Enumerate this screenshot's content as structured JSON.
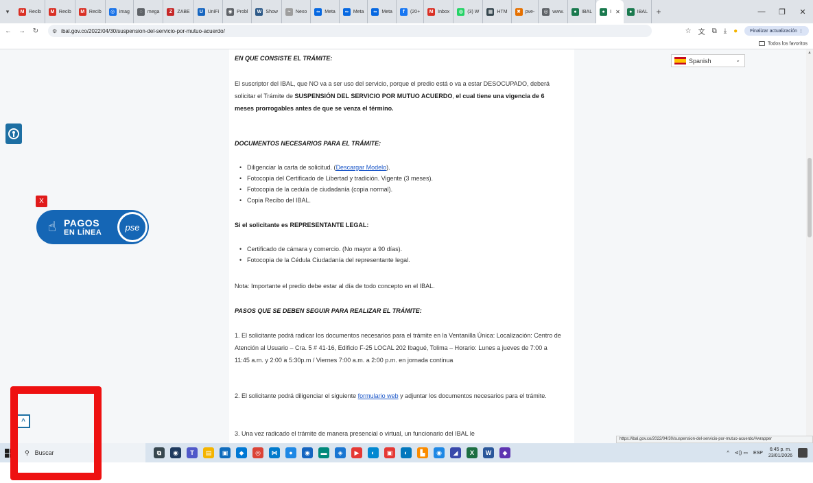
{
  "browser": {
    "tab_menu_icon": "chevron-down-icon",
    "tabs": [
      {
        "label": "Recib",
        "icon": "gmail-icon",
        "color": "#d93025",
        "glyph": "M"
      },
      {
        "label": "Recib",
        "icon": "gmail-icon",
        "color": "#d93025",
        "glyph": "M"
      },
      {
        "label": "Recib",
        "icon": "gmail-icon",
        "color": "#d93025",
        "glyph": "M"
      },
      {
        "label": "imag",
        "icon": "image-icon",
        "color": "#1a73e8",
        "glyph": "◎"
      },
      {
        "label": "mega",
        "icon": "globe-icon",
        "color": "#5f6368",
        "glyph": "◌"
      },
      {
        "label": "ZABE",
        "icon": "zabbix-icon",
        "color": "#c62828",
        "glyph": "Z"
      },
      {
        "label": "UniFi",
        "icon": "unifi-icon",
        "color": "#1565c0",
        "glyph": "U"
      },
      {
        "label": "Probl",
        "icon": "globe-icon",
        "color": "#5f6368",
        "glyph": "◉"
      },
      {
        "label": "Show",
        "icon": "app-icon",
        "color": "#2e5a88",
        "glyph": "W"
      },
      {
        "label": "Nexo",
        "icon": "cloud-icon",
        "color": "#9e9e9e",
        "glyph": "~"
      },
      {
        "label": "Meta",
        "icon": "meta-icon",
        "color": "#0668e1",
        "glyph": "∞"
      },
      {
        "label": "Meta",
        "icon": "meta-icon",
        "color": "#0668e1",
        "glyph": "∞"
      },
      {
        "label": "Meta",
        "icon": "meta-icon",
        "color": "#0668e1",
        "glyph": "∞"
      },
      {
        "label": "(20+",
        "icon": "facebook-icon",
        "color": "#1877f2",
        "glyph": "f"
      },
      {
        "label": "Inbox",
        "icon": "gmail-icon",
        "color": "#d93025",
        "glyph": "M"
      },
      {
        "label": "(3) W",
        "icon": "whatsapp-icon",
        "color": "#25d366",
        "glyph": "◍"
      },
      {
        "label": "HTM",
        "icon": "html-icon",
        "color": "#37474f",
        "glyph": "▦"
      },
      {
        "label": "pve-",
        "icon": "proxmox-icon",
        "color": "#e57000",
        "glyph": "✖"
      },
      {
        "label": "www.",
        "icon": "globe-icon",
        "color": "#5f6368",
        "glyph": "◎"
      },
      {
        "label": "IBAL",
        "icon": "ibal-icon",
        "color": "#1b7a4f",
        "glyph": "●"
      }
    ],
    "active_tab": {
      "label": "I",
      "icon": "ibal-icon",
      "color": "#1b7a4f",
      "glyph": "●",
      "close": "✕"
    },
    "after_tab": {
      "label": "IBAL",
      "icon": "ibal-icon",
      "color": "#1b7a4f",
      "glyph": "●"
    },
    "new_tab": "+",
    "url": "ibal.gov.co/2022/04/30/suspension-del-servicio-por-mutuo-acuerdo/",
    "update_button": "Finalizar actualización",
    "bookmark_folder": "Todos los favoritos",
    "status_url": "https://ibal.gov.co/2022/04/30/suspension-del-servicio-por-mutuo-acuerdo/#wrapper"
  },
  "page": {
    "language": "Spanish",
    "section1_heading": "EN QUE CONSISTE EL TRÁMITE:",
    "intro_normal_1": "El suscriptor del IBAL, que NO va a ser uso del servicio, porque el predio está o va a estar DESOCUPADO, deberá solicitar el Trámite de ",
    "intro_bold_1": "SUSPENSIÓN DEL SERVICIO POR MUTUO ACUERDO",
    "intro_normal_2": ",  ",
    "intro_bold_2": "el cual tiene una vigencia de 6 meses prorrogables antes de que se venza el término.",
    "section2_heading": "DOCUMENTOS NECESARIOS PARA EL TRÁMITE:",
    "doc_item_1_text": "Diligenciar la carta de solicitud. (",
    "doc_item_1_link": "Descargar Modelo",
    "doc_item_1_end": ").",
    "doc_item_2": "Fotocopia del Certificado de Libertad y tradición. Vigente (3 meses).",
    "doc_item_3": "Fotocopia de la cedula de ciudadanía (copia normal).",
    "doc_item_4": "Copia Recibo del IBAL.",
    "section3_heading": "Si el solicitante es REPRESENTANTE LEGAL:",
    "rep_item_1": "Certificado de cámara y comercio. (No mayor a 90 días).",
    "rep_item_2": "Fotocopia de la Cédula Ciudadanía del representante legal.",
    "note": "Nota: Importante el predio debe estar al día de todo concepto en el IBAL.",
    "section4_heading": "PASOS QUE SE DEBEN SEGUIR PARA REALIZAR EL TRÁMITE:",
    "step1": "1. El solicitante podrá radicar los documentos necesarios para el trámite en la Ventanilla Única: Localización: Centro de Atención al Usuario – Cra. 5 # 41-16, Edificio F-25 LOCAL 202 Ibagué, Tolima – Horario: Lunes a jueves de 7:00 a 11:45 a.m. y 2:00 a 5:30p.m / Viernes 7:00 a.m. a 2:00 p.m. en jornada continua",
    "step2_a": "2. El solicitante podrá diligenciar el siguiente ",
    "step2_link": "formulario web",
    "step2_b": " y adjuntar los documentos necesarios para el trámite.",
    "step3": "3. Una vez radicado el trámite de manera presencial o virtual, un funcionario del IBAL le",
    "pse_close": "X",
    "pse_line1": "PAGOS",
    "pse_line2": "EN LÍNEA",
    "pse_logo": "pse",
    "back_to_top": "^"
  },
  "taskbar": {
    "search_placeholder": "Buscar",
    "apps": [
      {
        "icon": "task-view-icon",
        "color": "#37474f",
        "glyph": "⧉"
      },
      {
        "icon": "chrome-icon",
        "color": "#1e3a5f",
        "glyph": "◉"
      },
      {
        "icon": "teams-icon",
        "color": "#5059c9",
        "glyph": "T"
      },
      {
        "icon": "file-explorer-icon",
        "color": "#f4b400",
        "glyph": "▤"
      },
      {
        "icon": "store-icon",
        "color": "#0f6cbd",
        "glyph": "▣"
      },
      {
        "icon": "app-icon",
        "color": "#0078d4",
        "glyph": "◆"
      },
      {
        "icon": "chrome-icon",
        "color": "#db4437",
        "glyph": "◎"
      },
      {
        "icon": "vscode-icon",
        "color": "#007acc",
        "glyph": "⋈"
      },
      {
        "icon": "app-icon",
        "color": "#1e88e5",
        "glyph": "●"
      },
      {
        "icon": "app-icon",
        "color": "#1565c0",
        "glyph": "◉"
      },
      {
        "icon": "app-icon",
        "color": "#00897b",
        "glyph": "▬"
      },
      {
        "icon": "app-icon",
        "color": "#1976d2",
        "glyph": "◈"
      },
      {
        "icon": "youtube-icon",
        "color": "#e53935",
        "glyph": "▶"
      },
      {
        "icon": "app-icon",
        "color": "#0288d1",
        "glyph": "◐"
      },
      {
        "icon": "app-icon",
        "color": "#e53935",
        "glyph": "▣"
      },
      {
        "icon": "app-icon",
        "color": "#0277bd",
        "glyph": "◐"
      },
      {
        "icon": "app-icon",
        "color": "#fb8c00",
        "glyph": "▙"
      },
      {
        "icon": "app-icon",
        "color": "#1e88e5",
        "glyph": "◉"
      },
      {
        "icon": "app-icon",
        "color": "#3949ab",
        "glyph": "◢"
      },
      {
        "icon": "excel-icon",
        "color": "#1d6f42",
        "glyph": "X"
      },
      {
        "icon": "word-icon",
        "color": "#2b579a",
        "glyph": "W"
      },
      {
        "icon": "app-icon",
        "color": "#5e35b1",
        "glyph": "◆"
      }
    ],
    "tray_arrow": "^",
    "tray_icons": "⊲)) ▭",
    "lang": "ESP",
    "time": "6:45 p. m.",
    "date": "23/01/2026"
  },
  "colors": {
    "link": "#1a56c8",
    "pse_blue": "#1566b5",
    "annotation_red": "#ee1111",
    "a11y_blue": "#1d6fa3"
  }
}
